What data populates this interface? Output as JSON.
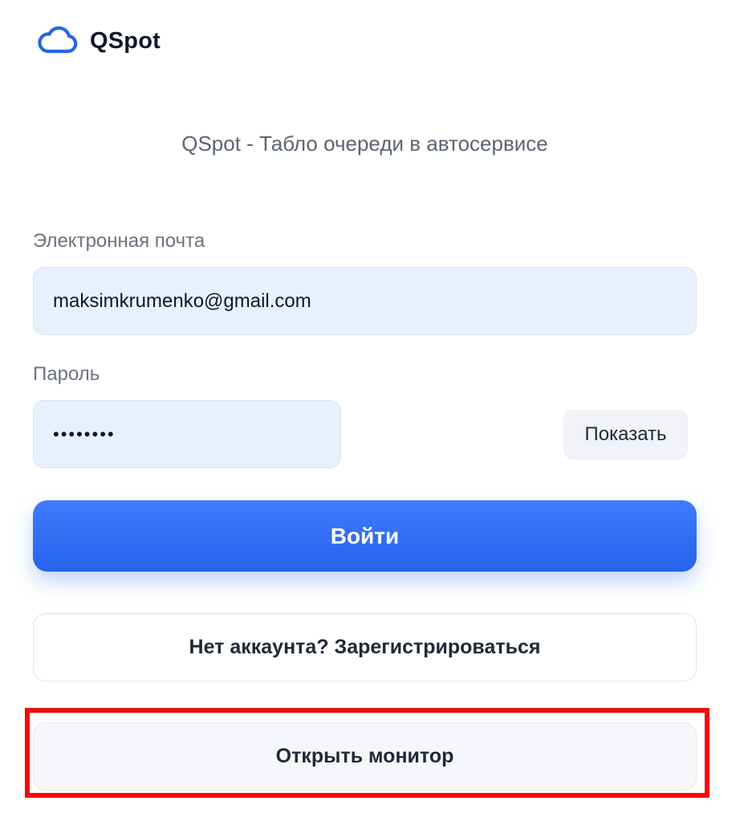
{
  "brand": {
    "name": "QSpot",
    "logo_icon": "cloud-icon",
    "accent_color": "#2563eb"
  },
  "subtitle": "QSpot - Табло очереди в автосервисе",
  "form": {
    "email_label": "Электронная почта",
    "email_value": "maksimkrumenko@gmail.com",
    "password_label": "Пароль",
    "password_value": "••••••••",
    "show_label": "Показать"
  },
  "actions": {
    "login_label": "Войти",
    "register_label": "Нет аккаунта? Зарегистрироваться",
    "monitor_label": "Открыть монитор"
  },
  "annotation": {
    "highlight_color": "#f30a0a"
  }
}
